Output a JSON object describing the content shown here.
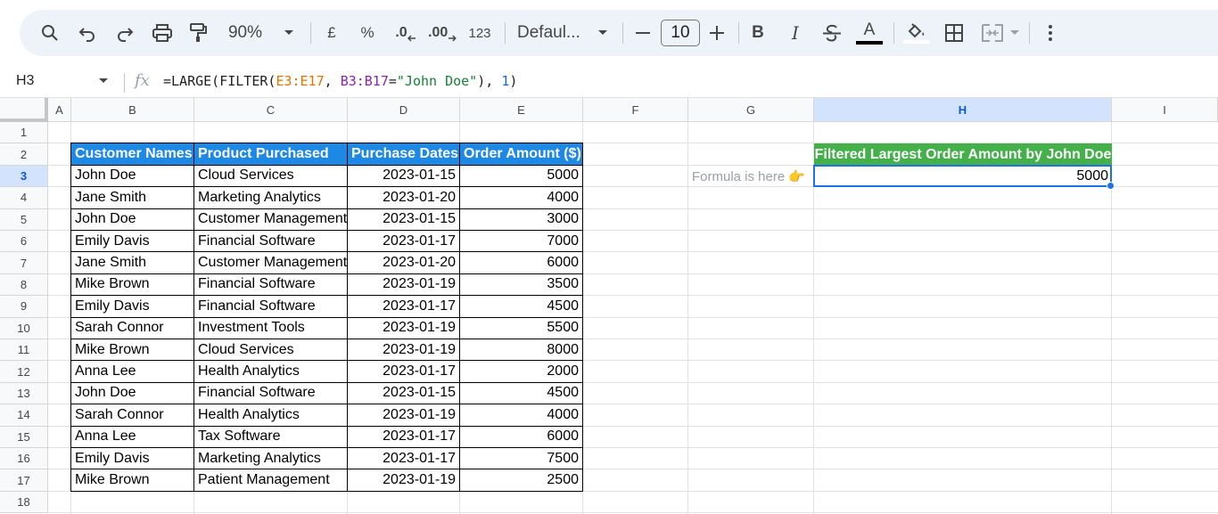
{
  "toolbar": {
    "zoom": "90%",
    "currency": "£",
    "percent": "%",
    "decrease_decimal": ".0",
    "increase_decimal": ".00",
    "number_format": "123",
    "font_name": "Defaul...",
    "font_size": "10",
    "bold": "B",
    "italic": "I",
    "text_color_letter": "A"
  },
  "formula_bar": {
    "cell_ref": "H3",
    "fx": "fx",
    "formula_parts": [
      "=LARGE(FILTER(",
      "E3:E17",
      ", ",
      "B3:B17",
      "=",
      "\"John Doe\"",
      "), ",
      "1",
      ")"
    ]
  },
  "columns": [
    "A",
    "B",
    "C",
    "D",
    "E",
    "F",
    "G",
    "H",
    "I"
  ],
  "selected_column": "H",
  "rows": [
    "1",
    "2",
    "3",
    "4",
    "5",
    "6",
    "7",
    "8",
    "9",
    "10",
    "11",
    "12",
    "13",
    "14",
    "15",
    "16",
    "17",
    "18"
  ],
  "selected_row": "3",
  "table": {
    "headers": [
      "Customer Names",
      "Product Purchased",
      "Purchase Dates",
      "Order Amount ($)"
    ],
    "rows": [
      [
        "John Doe",
        "Cloud Services",
        "2023-01-15",
        "5000"
      ],
      [
        "Jane Smith",
        "Marketing Analytics",
        "2023-01-20",
        "4000"
      ],
      [
        "John Doe",
        "Customer Management",
        "2023-01-15",
        "3000"
      ],
      [
        "Emily Davis",
        "Financial Software",
        "2023-01-17",
        "7000"
      ],
      [
        "Jane Smith",
        "Customer Management",
        "2023-01-20",
        "6000"
      ],
      [
        "Mike Brown",
        "Financial Software",
        "2023-01-19",
        "3500"
      ],
      [
        "Emily Davis",
        "Financial Software",
        "2023-01-17",
        "4500"
      ],
      [
        "Sarah Connor",
        "Investment Tools",
        "2023-01-19",
        "5500"
      ],
      [
        "Mike Brown",
        "Cloud Services",
        "2023-01-19",
        "8000"
      ],
      [
        "Anna Lee",
        "Health Analytics",
        "2023-01-17",
        "2000"
      ],
      [
        "John Doe",
        "Financial Software",
        "2023-01-15",
        "4500"
      ],
      [
        "Sarah Connor",
        "Health Analytics",
        "2023-01-19",
        "4000"
      ],
      [
        "Anna Lee",
        "Tax Software",
        "2023-01-17",
        "6000"
      ],
      [
        "Emily Davis",
        "Marketing Analytics",
        "2023-01-17",
        "7500"
      ],
      [
        "Mike Brown",
        "Patient Management",
        "2023-01-19",
        "2500"
      ]
    ]
  },
  "result": {
    "header": "Filtered Largest Order Amount by John Doe",
    "value": "5000",
    "note": "Formula is here 👉"
  },
  "colors": {
    "table_header": "#1e88e5",
    "result_header": "#43b049",
    "selection": "#1a73e8",
    "toolbar_bg": "#eef2f9"
  }
}
